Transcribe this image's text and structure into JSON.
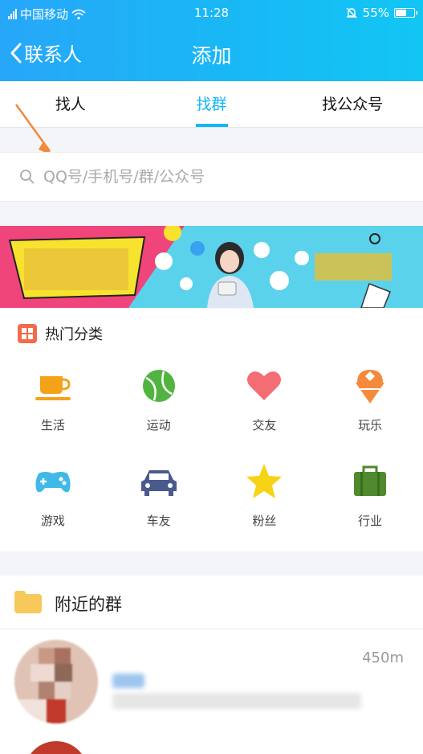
{
  "status_bar": {
    "carrier": "中国移动",
    "time": "11:28",
    "battery": "55%",
    "icons": [
      "signal-icon",
      "wifi-icon",
      "alarm-icon",
      "battery-icon"
    ]
  },
  "nav": {
    "back_label": "联系人",
    "title": "添加"
  },
  "tabs": [
    {
      "label": "找人",
      "active": false
    },
    {
      "label": "找群",
      "active": true
    },
    {
      "label": "找公众号",
      "active": false
    }
  ],
  "search": {
    "placeholder": "QQ号/手机号/群/公众号"
  },
  "categories": {
    "title": "热门分类",
    "items": [
      {
        "label": "生活",
        "icon": "cup-icon"
      },
      {
        "label": "运动",
        "icon": "ball-icon"
      },
      {
        "label": "交友",
        "icon": "heart-icon"
      },
      {
        "label": "玩乐",
        "icon": "ice-cream-icon"
      },
      {
        "label": "游戏",
        "icon": "gamepad-icon"
      },
      {
        "label": "车友",
        "icon": "car-icon"
      },
      {
        "label": "粉丝",
        "icon": "star-icon"
      },
      {
        "label": "行业",
        "icon": "briefcase-icon"
      }
    ]
  },
  "nearby": {
    "title": "附近的群",
    "items": [
      {
        "distance": "450m"
      }
    ]
  },
  "colors": {
    "accent": "#12b7f5",
    "header_start": "#27a7f8",
    "header_end": "#12c6f4"
  }
}
